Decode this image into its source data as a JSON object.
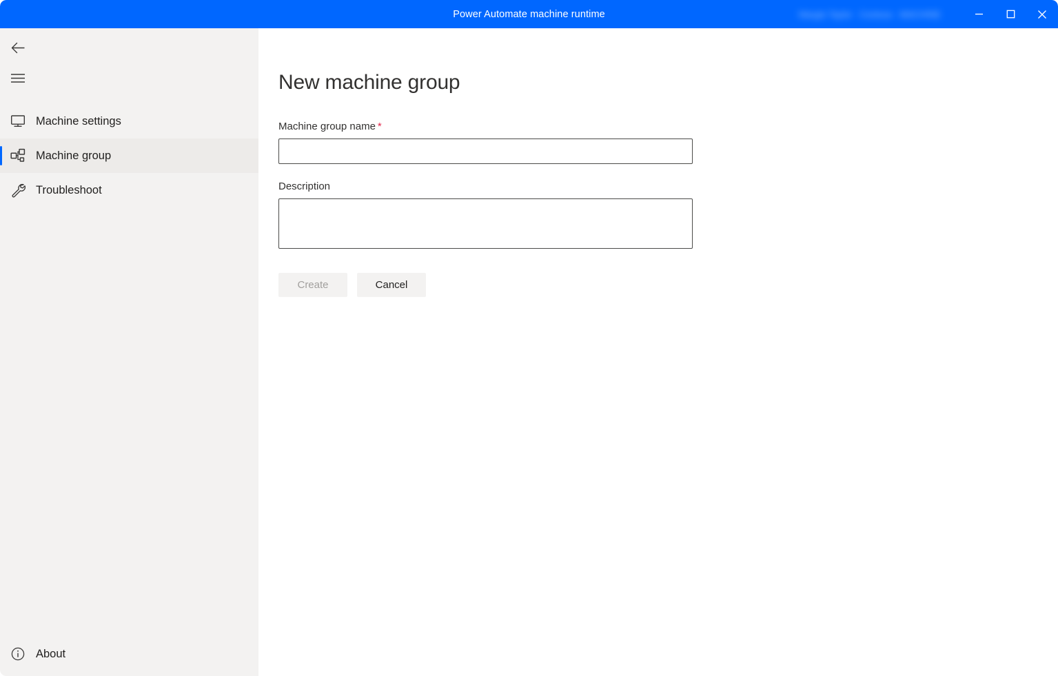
{
  "window": {
    "title": "Power Automate machine runtime",
    "accent_color": "#0067FF",
    "sidebar_bg": "#F3F2F1",
    "account_blurred": [
      "Margie Taylor",
      "Contoso",
      "MACHINE"
    ],
    "controls": {
      "minimize": "minimize-icon",
      "maximize": "maximize-icon",
      "close": "close-icon"
    }
  },
  "sidebar": {
    "back_icon": "back-arrow-icon",
    "menu_icon": "hamburger-menu-icon",
    "items": [
      {
        "label": "Machine settings",
        "icon": "monitor-icon",
        "active": false
      },
      {
        "label": "Machine group",
        "icon": "machine-group-icon",
        "active": true
      },
      {
        "label": "Troubleshoot",
        "icon": "wrench-icon",
        "active": false
      }
    ],
    "about": {
      "label": "About",
      "icon": "info-circle-icon"
    }
  },
  "main": {
    "page_title": "New machine group",
    "fields": {
      "name": {
        "label": "Machine group name",
        "required_marker": "*",
        "value": "",
        "placeholder": ""
      },
      "description": {
        "label": "Description",
        "value": "",
        "placeholder": ""
      }
    },
    "buttons": {
      "create": {
        "label": "Create",
        "disabled": true
      },
      "cancel": {
        "label": "Cancel",
        "disabled": false
      }
    }
  }
}
